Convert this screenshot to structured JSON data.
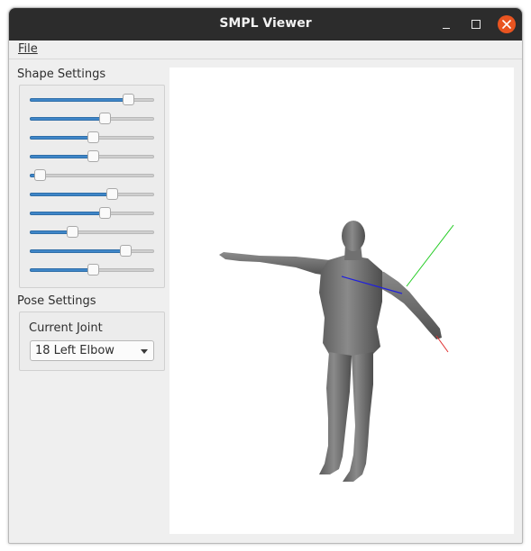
{
  "window": {
    "title": "SMPL Viewer"
  },
  "menu": {
    "file": "File"
  },
  "shape_settings": {
    "title": "Shape Settings",
    "sliders": [
      0.79,
      0.6,
      0.51,
      0.51,
      0.08,
      0.66,
      0.6,
      0.34,
      0.77,
      0.51
    ]
  },
  "pose_settings": {
    "title": "Pose Settings",
    "current_joint_label": "Current Joint",
    "current_joint_value": "18 Left Elbow"
  },
  "colors": {
    "titlebar": "#2c2c2c",
    "close_button": "#e95420",
    "slider_fill": "#3f86c8",
    "axis_x": "#e03030",
    "axis_y": "#22cc22",
    "axis_z": "#2020dd",
    "body": "#6f6f6f"
  }
}
